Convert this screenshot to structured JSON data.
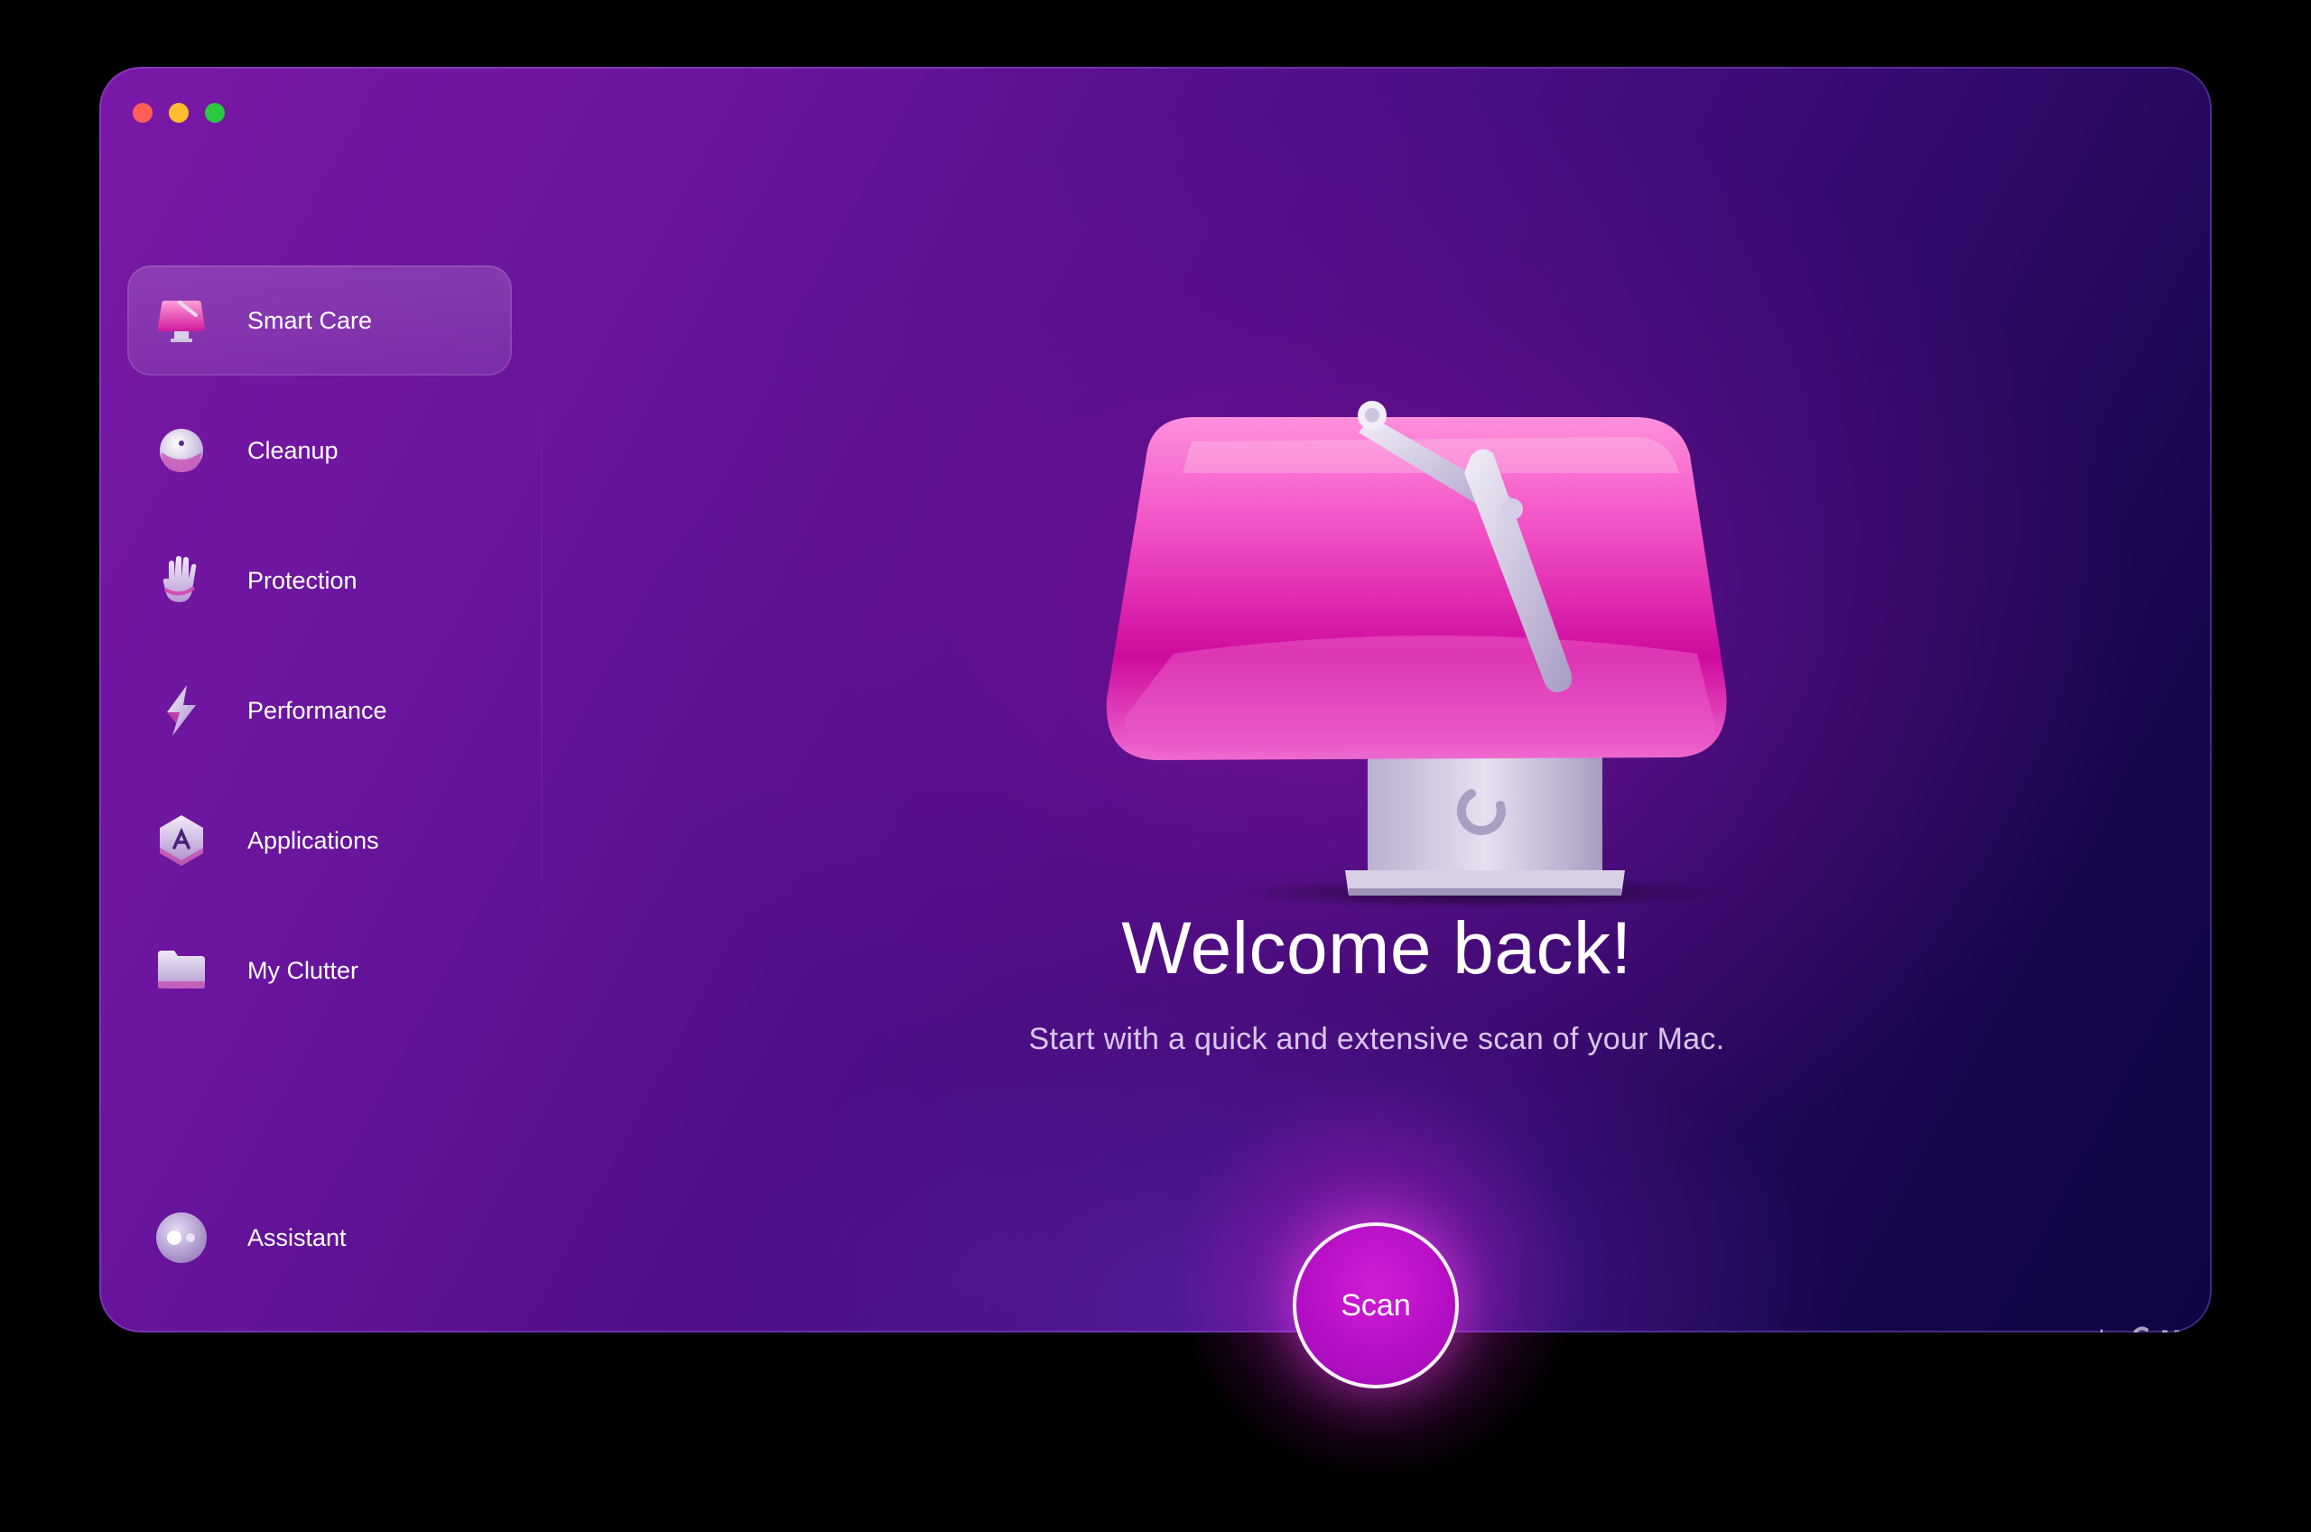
{
  "window": {
    "traffic_lights": [
      "close",
      "minimize",
      "maximize"
    ]
  },
  "sidebar": {
    "items": [
      {
        "label": "Smart Care",
        "icon": "smart-care-icon",
        "active": true
      },
      {
        "label": "Cleanup",
        "icon": "cleanup-icon",
        "active": false
      },
      {
        "label": "Protection",
        "icon": "protection-icon",
        "active": false
      },
      {
        "label": "Performance",
        "icon": "performance-icon",
        "active": false
      },
      {
        "label": "Applications",
        "icon": "applications-icon",
        "active": false
      },
      {
        "label": "My Clutter",
        "icon": "my-clutter-icon",
        "active": false
      }
    ],
    "assistant": {
      "label": "Assistant",
      "icon": "assistant-icon"
    }
  },
  "main": {
    "title": "Welcome back!",
    "subtitle": "Start with a quick and extensive scan of your Mac.",
    "scan_button": "Scan",
    "hero_icon": "imac-wiper-icon"
  },
  "brand": {
    "prefix": "by",
    "name": "MacPaw"
  },
  "colors": {
    "accent": "#b30ec4",
    "close": "#ff5f57",
    "minimize": "#febc2e",
    "maximize": "#28c840"
  }
}
